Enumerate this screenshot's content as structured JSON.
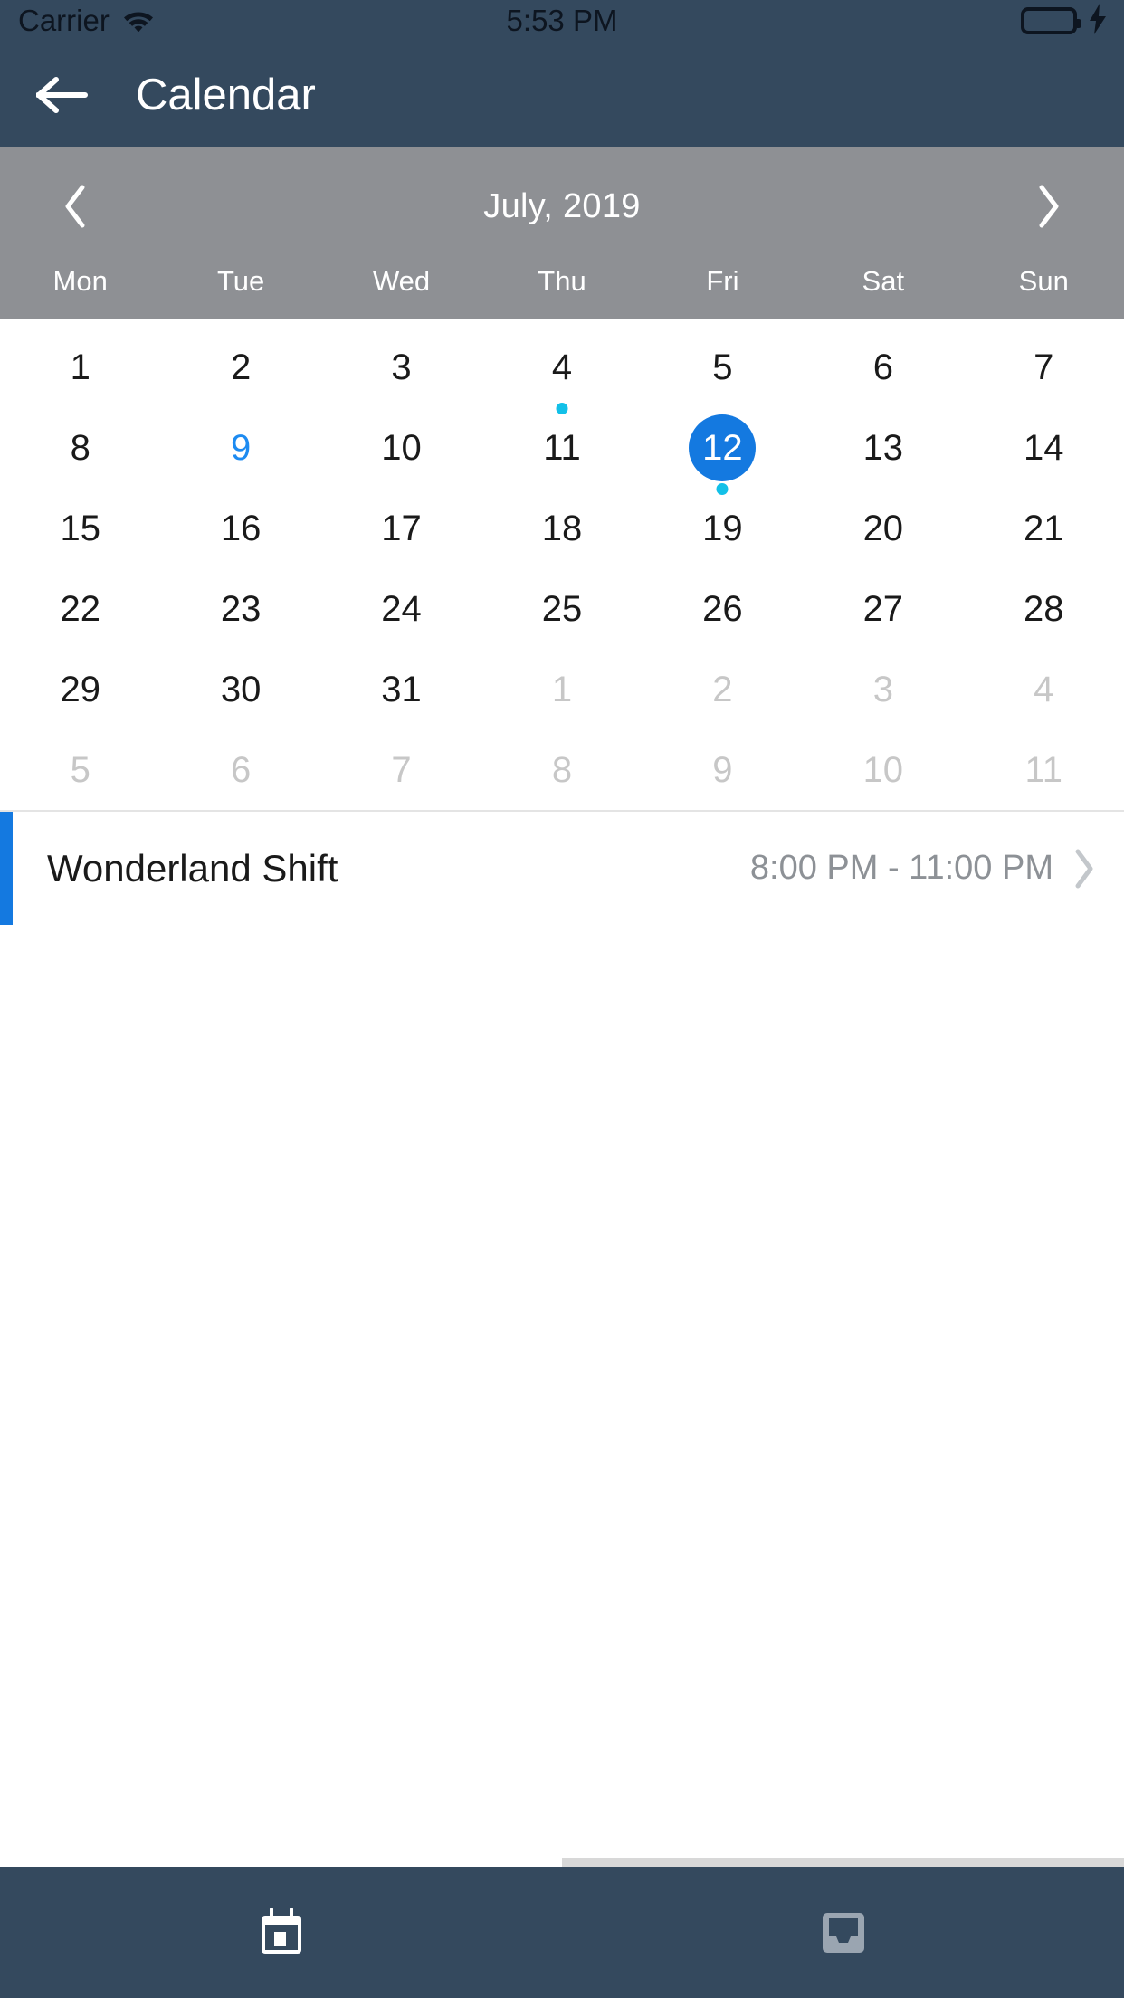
{
  "status_bar": {
    "carrier": "Carrier",
    "time": "5:53 PM",
    "wifi_icon": "wifi-icon",
    "battery_icon": "battery-full-icon",
    "charging_icon": "lightning-bolt-icon"
  },
  "nav": {
    "back_icon": "arrow-left-icon",
    "title": "Calendar"
  },
  "month_selector": {
    "prev_icon": "chevron-left-icon",
    "next_icon": "chevron-right-icon",
    "label": "July, 2019"
  },
  "weekdays": [
    "Mon",
    "Tue",
    "Wed",
    "Thu",
    "Fri",
    "Sat",
    "Sun"
  ],
  "calendar": {
    "weeks": [
      [
        {
          "day": "1",
          "state": "normal",
          "dot": false
        },
        {
          "day": "2",
          "state": "normal",
          "dot": false
        },
        {
          "day": "3",
          "state": "normal",
          "dot": false
        },
        {
          "day": "4",
          "state": "normal",
          "dot": true
        },
        {
          "day": "5",
          "state": "normal",
          "dot": false
        },
        {
          "day": "6",
          "state": "normal",
          "dot": false
        },
        {
          "day": "7",
          "state": "normal",
          "dot": false
        }
      ],
      [
        {
          "day": "8",
          "state": "normal",
          "dot": false
        },
        {
          "day": "9",
          "state": "today",
          "dot": false
        },
        {
          "day": "10",
          "state": "normal",
          "dot": false
        },
        {
          "day": "11",
          "state": "normal",
          "dot": false
        },
        {
          "day": "12",
          "state": "selected",
          "dot": true
        },
        {
          "day": "13",
          "state": "normal",
          "dot": false
        },
        {
          "day": "14",
          "state": "normal",
          "dot": false
        }
      ],
      [
        {
          "day": "15",
          "state": "normal",
          "dot": false
        },
        {
          "day": "16",
          "state": "normal",
          "dot": false
        },
        {
          "day": "17",
          "state": "normal",
          "dot": false
        },
        {
          "day": "18",
          "state": "normal",
          "dot": false
        },
        {
          "day": "19",
          "state": "normal",
          "dot": false
        },
        {
          "day": "20",
          "state": "normal",
          "dot": false
        },
        {
          "day": "21",
          "state": "normal",
          "dot": false
        }
      ],
      [
        {
          "day": "22",
          "state": "normal",
          "dot": false
        },
        {
          "day": "23",
          "state": "normal",
          "dot": false
        },
        {
          "day": "24",
          "state": "normal",
          "dot": false
        },
        {
          "day": "25",
          "state": "normal",
          "dot": false
        },
        {
          "day": "26",
          "state": "normal",
          "dot": false
        },
        {
          "day": "27",
          "state": "normal",
          "dot": false
        },
        {
          "day": "28",
          "state": "normal",
          "dot": false
        }
      ],
      [
        {
          "day": "29",
          "state": "normal",
          "dot": false
        },
        {
          "day": "30",
          "state": "normal",
          "dot": false
        },
        {
          "day": "31",
          "state": "normal",
          "dot": false
        },
        {
          "day": "1",
          "state": "muted",
          "dot": false
        },
        {
          "day": "2",
          "state": "muted",
          "dot": false
        },
        {
          "day": "3",
          "state": "muted",
          "dot": false
        },
        {
          "day": "4",
          "state": "muted",
          "dot": false
        }
      ],
      [
        {
          "day": "5",
          "state": "muted",
          "dot": false
        },
        {
          "day": "6",
          "state": "muted",
          "dot": false
        },
        {
          "day": "7",
          "state": "muted",
          "dot": false
        },
        {
          "day": "8",
          "state": "muted",
          "dot": false
        },
        {
          "day": "9",
          "state": "muted",
          "dot": false
        },
        {
          "day": "10",
          "state": "muted",
          "dot": false
        },
        {
          "day": "11",
          "state": "muted",
          "dot": false
        }
      ]
    ]
  },
  "events": [
    {
      "title": "Wonderland Shift",
      "time": "8:00 PM - 11:00 PM",
      "chevron_icon": "chevron-right-icon",
      "accent_color": "#1479e0"
    }
  ],
  "tab_bar": {
    "tabs": [
      {
        "icon": "calendar-icon",
        "active": true
      },
      {
        "icon": "inbox-tray-icon",
        "active": false
      }
    ]
  },
  "colors": {
    "nav_background": "#34495e",
    "month_bar": "#8e9094",
    "selected_day": "#1479e0",
    "today_text": "#1d8bf1",
    "event_dot": "#12c0e8",
    "battery_green": "#4cd964"
  }
}
